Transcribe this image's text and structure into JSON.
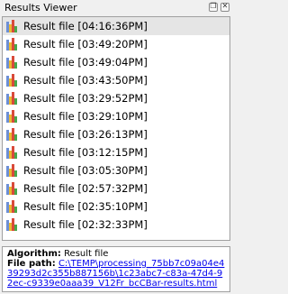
{
  "panel": {
    "title": "Results Viewer",
    "float_glyph": "❐",
    "close_glyph": "✕"
  },
  "results": [
    {
      "label": "Result file [04:16:36PM]",
      "selected": true
    },
    {
      "label": "Result file [03:49:20PM]",
      "selected": false
    },
    {
      "label": "Result file [03:49:04PM]",
      "selected": false
    },
    {
      "label": "Result file [03:43:50PM]",
      "selected": false
    },
    {
      "label": "Result file [03:29:52PM]",
      "selected": false
    },
    {
      "label": "Result file [03:29:10PM]",
      "selected": false
    },
    {
      "label": "Result file [03:26:13PM]",
      "selected": false
    },
    {
      "label": "Result file [03:12:15PM]",
      "selected": false
    },
    {
      "label": "Result file [03:05:30PM]",
      "selected": false
    },
    {
      "label": "Result file [02:57:32PM]",
      "selected": false
    },
    {
      "label": "Result file [02:35:10PM]",
      "selected": false
    },
    {
      "label": "Result file [02:32:33PM]",
      "selected": false
    }
  ],
  "icon": {
    "name": "bar-chart-icon",
    "colors": [
      "#6c8fd6",
      "#e8b830",
      "#d94a3a",
      "#4aa84a"
    ]
  },
  "details": {
    "algorithm_label": "Algorithm:",
    "algorithm_value": "Result file",
    "path_label": "File path:",
    "path_value": "C:\\TEMP\\processing_75bb7c09a04e439293d2c355b887156b\\1c23abc7-c83a-47d4-92ec-c9339e0aaa39_V12Fr_bcCBar-results.html"
  },
  "colors": {
    "selected_row": "#e5e5e5",
    "link": "#0000ee"
  }
}
